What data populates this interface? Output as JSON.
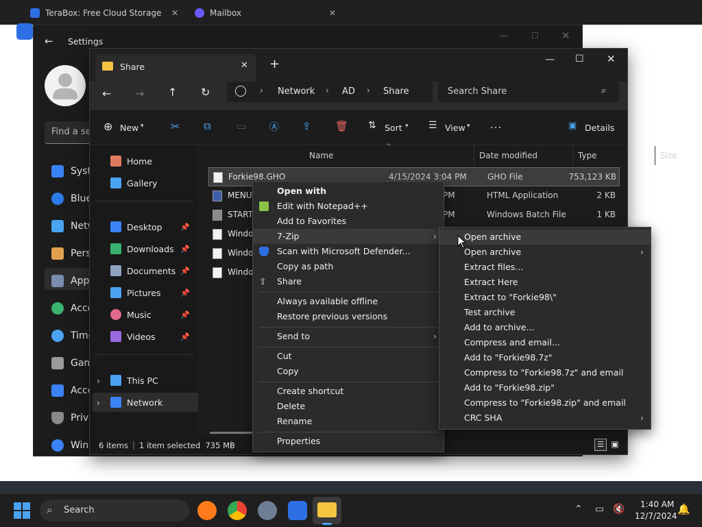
{
  "browser": {
    "tabs": [
      {
        "label": "TeraBox: Free Cloud Storage"
      },
      {
        "label": "Mailbox"
      }
    ]
  },
  "settings": {
    "title": "Settings",
    "search_placeholder": "Find a setting",
    "nav": [
      {
        "label": "System"
      },
      {
        "label": "Bluetooth & devices"
      },
      {
        "label": "Network & internet"
      },
      {
        "label": "Personalization"
      },
      {
        "label": "Apps"
      },
      {
        "label": "Accounts"
      },
      {
        "label": "Time & language"
      },
      {
        "label": "Gaming"
      },
      {
        "label": "Accessibility"
      },
      {
        "label": "Privacy & security"
      },
      {
        "label": "Windows Update"
      }
    ]
  },
  "explorer": {
    "tab_title": "Share",
    "breadcrumb": [
      "Network",
      "AD",
      "Share"
    ],
    "search_placeholder": "Search Share",
    "toolbar": {
      "new": "New",
      "sort": "Sort",
      "view": "View",
      "more": "...",
      "details": "Details"
    },
    "sidebar": {
      "top": [
        {
          "label": "Home"
        },
        {
          "label": "Gallery"
        }
      ],
      "quick": [
        {
          "label": "Desktop"
        },
        {
          "label": "Downloads"
        },
        {
          "label": "Documents"
        },
        {
          "label": "Pictures"
        },
        {
          "label": "Music"
        },
        {
          "label": "Videos"
        }
      ],
      "bottom": [
        {
          "label": "This PC"
        },
        {
          "label": "Network"
        }
      ]
    },
    "columns": {
      "name": "Name",
      "date": "Date modified",
      "type": "Type",
      "size": "Size"
    },
    "files": [
      {
        "name": "Forkie98.GHO",
        "date": "4/15/2024 3:04 PM",
        "type": "GHO File",
        "size": "753,123 KB"
      },
      {
        "name": "MENU",
        "date": "PM",
        "type": "HTML Application",
        "size": "2 KB"
      },
      {
        "name": "START",
        "date": "PM",
        "type": "Windows Batch File",
        "size": "1 KB"
      },
      {
        "name": "Window",
        "date": "",
        "type": "",
        "size": ""
      },
      {
        "name": "Window",
        "date": "",
        "type": "",
        "size": ""
      },
      {
        "name": "Window",
        "date": "",
        "type": "",
        "size": ""
      }
    ],
    "status": {
      "items": "6 items",
      "selected": "1 item selected  735 MB"
    }
  },
  "context_menu": {
    "items": [
      {
        "label": "Open with"
      },
      {
        "label": "Edit with Notepad++"
      },
      {
        "label": "Add to Favorites"
      },
      {
        "label": "7-Zip"
      },
      {
        "label": "Scan with Microsoft Defender..."
      },
      {
        "label": "Copy as path"
      },
      {
        "label": "Share"
      },
      {
        "label": "Always available offline"
      },
      {
        "label": "Restore previous versions"
      },
      {
        "label": "Send to"
      },
      {
        "label": "Cut"
      },
      {
        "label": "Copy"
      },
      {
        "label": "Create shortcut"
      },
      {
        "label": "Delete"
      },
      {
        "label": "Rename"
      },
      {
        "label": "Properties"
      }
    ]
  },
  "zip_menu": {
    "items": [
      {
        "label": "Open archive"
      },
      {
        "label": "Open archive"
      },
      {
        "label": "Extract files..."
      },
      {
        "label": "Extract Here"
      },
      {
        "label": "Extract to \"Forkie98\\\""
      },
      {
        "label": "Test archive"
      },
      {
        "label": "Add to archive..."
      },
      {
        "label": "Compress and email..."
      },
      {
        "label": "Add to \"Forkie98.7z\""
      },
      {
        "label": "Compress to \"Forkie98.7z\" and email"
      },
      {
        "label": "Add to \"Forkie98.zip\""
      },
      {
        "label": "Compress to \"Forkie98.zip\" and email"
      },
      {
        "label": "CRC SHA"
      }
    ]
  },
  "taskbar": {
    "search": "Search",
    "time": "1:40 AM",
    "date": "12/7/2024"
  },
  "colors": {
    "accent": "#3b82f6",
    "folder": "#f5c542",
    "selection": "#3d3d3d"
  }
}
